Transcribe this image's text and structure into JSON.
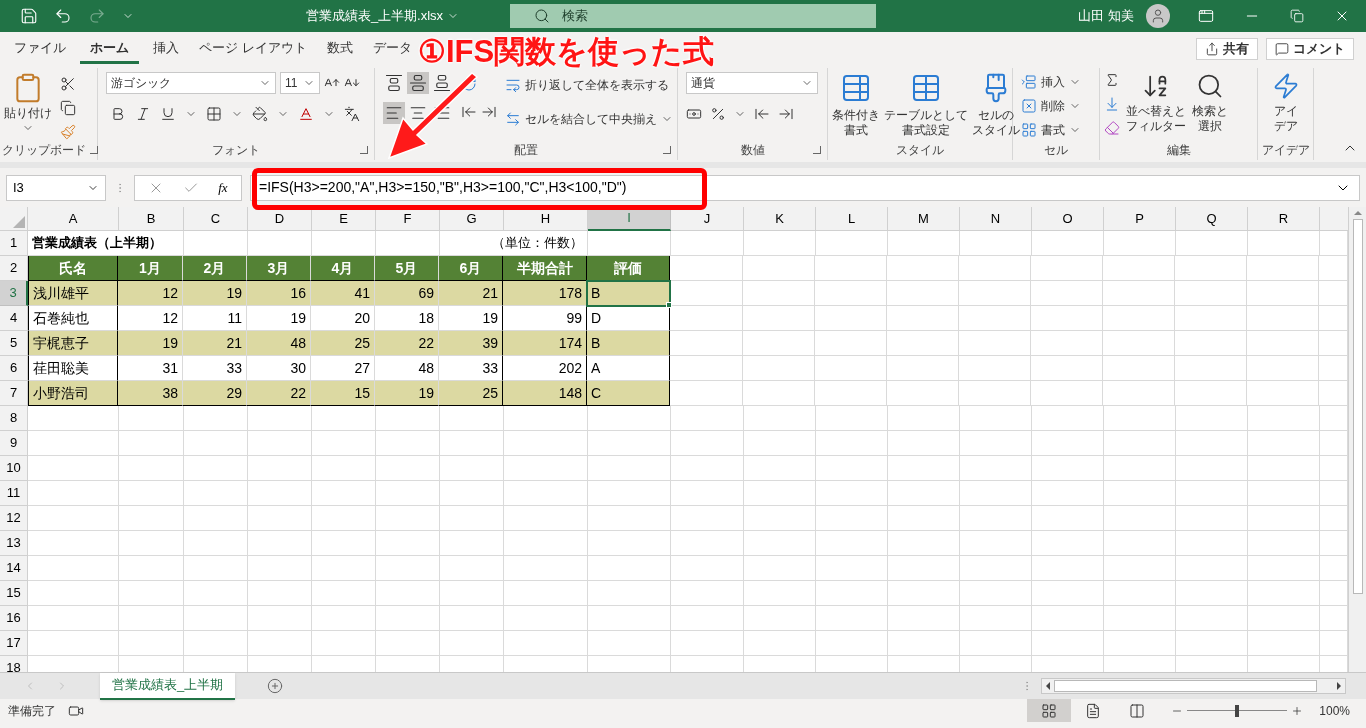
{
  "title_bar": {
    "quick_access": [
      {
        "kind": "save",
        "disabled": false
      },
      {
        "kind": "undo",
        "disabled": false
      },
      {
        "kind": "redo",
        "disabled": true
      }
    ],
    "file_name": "営業成績表_上半期.xlsx",
    "search_placeholder": "検索",
    "user": "山田 知美"
  },
  "ribbon_tabs": [
    {
      "label": "ファイル",
      "selected": false
    },
    {
      "label": "ホーム",
      "selected": true
    },
    {
      "label": "挿入",
      "selected": false
    },
    {
      "label": "ページ レイアウト",
      "selected": false
    },
    {
      "label": "数式",
      "selected": false
    },
    {
      "label": "データ",
      "selected": false
    }
  ],
  "share_button": "共有",
  "comment_button": "コメント",
  "ribbon": {
    "clipboard": {
      "paste": "貼り付け",
      "group": "クリップボード"
    },
    "font": {
      "name": "游ゴシック",
      "size": "11",
      "group": "フォント"
    },
    "alignment": {
      "vertical": [
        {
          "kind": "top",
          "selected": false
        },
        {
          "kind": "middle",
          "selected": true
        },
        {
          "kind": "bottom",
          "selected": false
        }
      ],
      "horizontal": [
        {
          "kind": "left",
          "selected": true
        },
        {
          "kind": "center",
          "selected": false
        },
        {
          "kind": "right",
          "selected": false
        }
      ],
      "wrap": "折り返して全体を表示する",
      "merge": "セルを結合して中央揃え",
      "group": "配置"
    },
    "number": {
      "format": "通貨",
      "group": "数値"
    },
    "styles": {
      "buttons": [
        {
          "kind": "conditional",
          "lines": [
            "条件付き",
            "書式"
          ]
        },
        {
          "kind": "table",
          "lines": [
            "テーブルとして",
            "書式設定"
          ]
        },
        {
          "kind": "cell",
          "lines": [
            "セルの",
            "スタイル"
          ]
        }
      ],
      "group": "スタイル"
    },
    "cells": {
      "buttons": [
        {
          "kind": "insert",
          "label": "挿入"
        },
        {
          "kind": "delete",
          "label": "削除"
        },
        {
          "kind": "format",
          "label": "書式"
        }
      ],
      "group": "セル"
    },
    "editing": {
      "buttons": [
        {
          "kind": "sort",
          "lines": [
            "並べ替えと",
            "フィルター"
          ]
        },
        {
          "kind": "find",
          "lines": [
            "検索と",
            "選択"
          ]
        }
      ],
      "group": "編集"
    },
    "ideas": {
      "lines": [
        "アイ",
        "デア"
      ],
      "group": "アイデア"
    }
  },
  "formula_bar": {
    "name_box": "I3",
    "function_label": "fx",
    "formula": "=IFS(H3>=200,\"A\",H3>=150,\"B\",H3>=100,\"C\",H3<100,\"D\")"
  },
  "annotation": {
    "text": "①IFS関数を使った式"
  },
  "sheet": {
    "columns": [
      {
        "label": "A",
        "selected": false
      },
      {
        "label": "B",
        "selected": false
      },
      {
        "label": "C",
        "selected": false
      },
      {
        "label": "D",
        "selected": false
      },
      {
        "label": "E",
        "selected": false
      },
      {
        "label": "F",
        "selected": false
      },
      {
        "label": "G",
        "selected": false
      },
      {
        "label": "H",
        "selected": false
      },
      {
        "label": "I",
        "selected": true
      },
      {
        "label": "J",
        "selected": false
      },
      {
        "label": "K",
        "selected": false
      },
      {
        "label": "L",
        "selected": false
      },
      {
        "label": "M",
        "selected": false
      },
      {
        "label": "N",
        "selected": false
      },
      {
        "label": "O",
        "selected": false
      },
      {
        "label": "P",
        "selected": false
      },
      {
        "label": "Q",
        "selected": false
      },
      {
        "label": "R",
        "selected": false
      }
    ],
    "rows": [
      {
        "kind": "title",
        "number": "1",
        "selected": false,
        "title": "営業成績表（上半期）",
        "unit": "（単位：件数）"
      },
      {
        "kind": "header",
        "number": "2",
        "selected": false,
        "cells": [
          "氏名",
          "1月",
          "2月",
          "3月",
          "4月",
          "5月",
          "6月",
          "半期合計",
          "評価"
        ]
      },
      {
        "kind": "data",
        "number": "3",
        "selected": true,
        "shaded": true,
        "cells": [
          "浅川雄平",
          "12",
          "19",
          "16",
          "41",
          "69",
          "21",
          "178",
          "B"
        ]
      },
      {
        "kind": "data",
        "number": "4",
        "selected": false,
        "shaded": false,
        "cells": [
          "石巻純也",
          "12",
          "11",
          "19",
          "20",
          "18",
          "19",
          "99",
          "D"
        ]
      },
      {
        "kind": "data",
        "number": "5",
        "selected": false,
        "shaded": true,
        "cells": [
          "宇梶恵子",
          "19",
          "21",
          "48",
          "25",
          "22",
          "39",
          "174",
          "B"
        ]
      },
      {
        "kind": "data",
        "number": "6",
        "selected": false,
        "shaded": false,
        "cells": [
          "荏田聡美",
          "31",
          "33",
          "30",
          "27",
          "48",
          "33",
          "202",
          "A"
        ]
      },
      {
        "kind": "data",
        "number": "7",
        "selected": false,
        "shaded": true,
        "cells": [
          "小野浩司",
          "38",
          "29",
          "22",
          "15",
          "19",
          "25",
          "148",
          "C"
        ]
      },
      {
        "kind": "empty",
        "number": "8",
        "selected": false
      },
      {
        "kind": "empty",
        "number": "9",
        "selected": false
      },
      {
        "kind": "empty",
        "number": "10",
        "selected": false
      },
      {
        "kind": "empty",
        "number": "11",
        "selected": false
      },
      {
        "kind": "empty",
        "number": "12",
        "selected": false
      },
      {
        "kind": "empty",
        "number": "13",
        "selected": false
      },
      {
        "kind": "empty",
        "number": "14",
        "selected": false
      },
      {
        "kind": "empty",
        "number": "15",
        "selected": false
      },
      {
        "kind": "empty",
        "number": "16",
        "selected": false
      },
      {
        "kind": "empty",
        "number": "17",
        "selected": false
      },
      {
        "kind": "empty",
        "number": "18",
        "selected": false
      }
    ]
  },
  "sheet_tabs": [
    {
      "label": "営業成績表_上半期",
      "selected": true
    }
  ],
  "status_bar": {
    "text": "準備完了",
    "views": [
      {
        "kind": "normal",
        "selected": true
      },
      {
        "kind": "page_layout",
        "selected": false
      },
      {
        "kind": "page_break",
        "selected": false
      }
    ],
    "zoom": {
      "level": 0.5,
      "reading": "100%"
    }
  }
}
